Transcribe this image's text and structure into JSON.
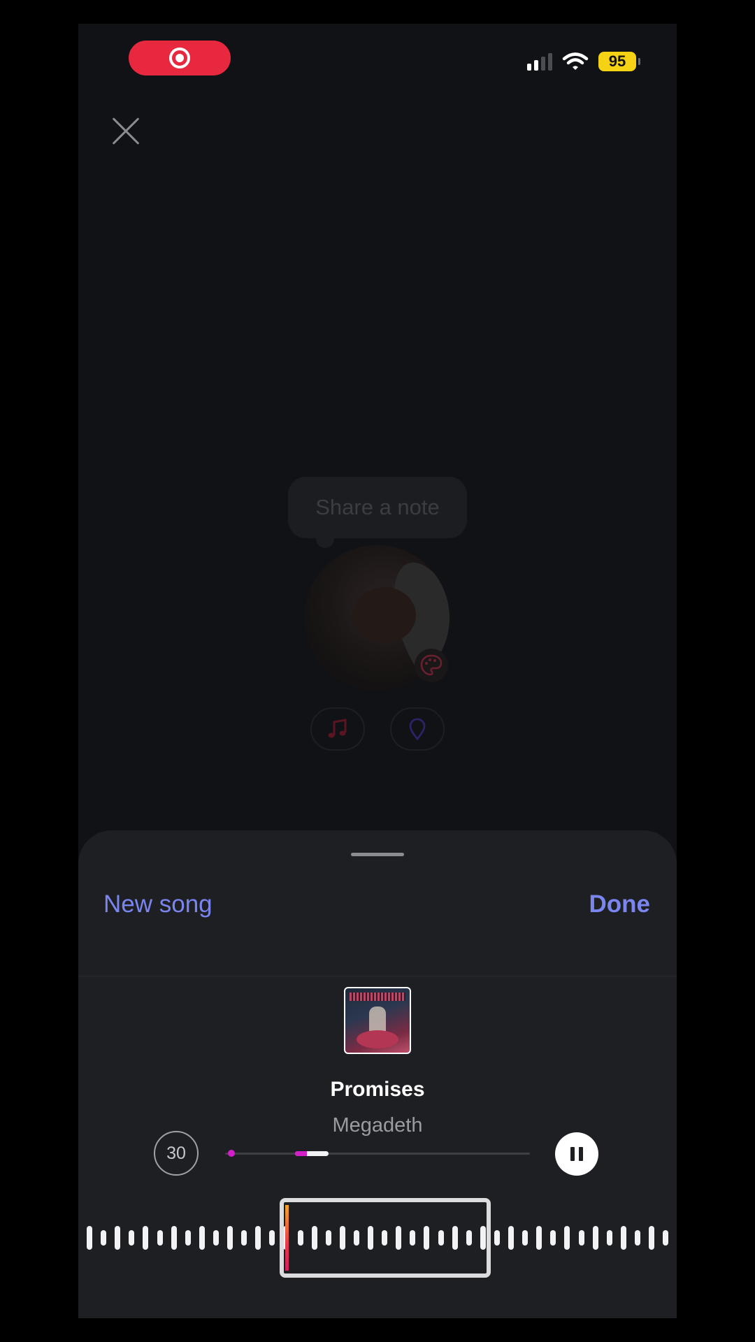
{
  "status_bar": {
    "recording_icon": "record-icon",
    "signal_bars_active": 2,
    "signal_bars_total": 4,
    "wifi_icon": "wifi-icon",
    "battery_level": "95",
    "battery_color": "#f5d213"
  },
  "composer": {
    "close_icon": "close-icon",
    "note_placeholder": "Share a note",
    "palette_icon": "palette-icon",
    "music_icon": "music-note-icon",
    "location_icon": "location-pin-icon"
  },
  "sheet": {
    "left_action": "New song",
    "right_action": "Done",
    "accent_color": "#7b85f0",
    "song": {
      "title": "Promises",
      "artist": "Megadeth"
    },
    "clip_duration": "30",
    "playback_progress": 0.35,
    "pause_icon": "pause-icon"
  }
}
